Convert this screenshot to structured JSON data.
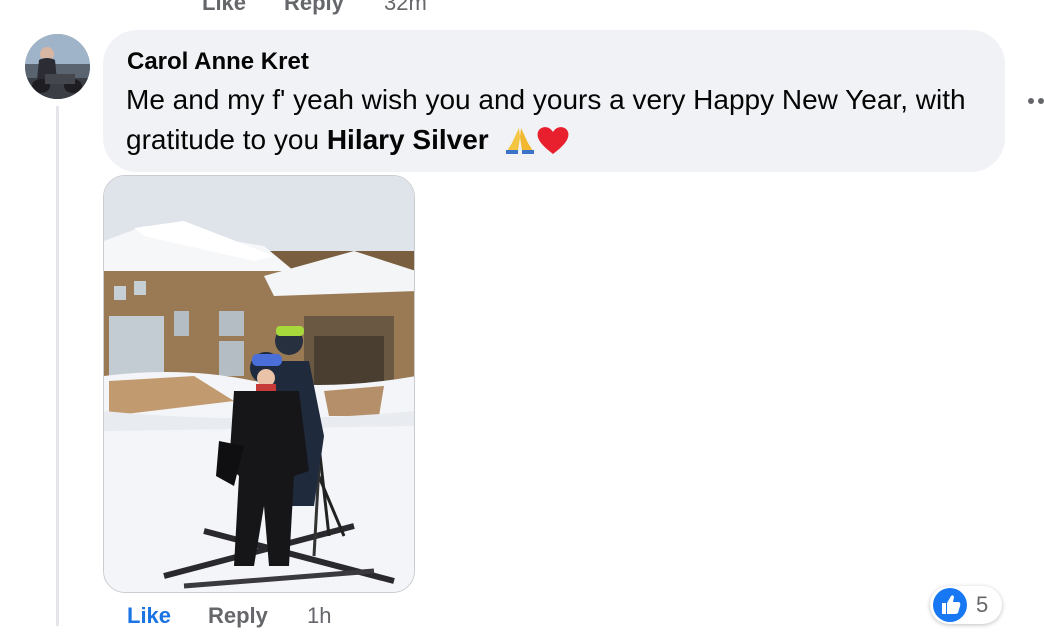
{
  "previous_comment_actions": {
    "like_label": "Like",
    "reply_label": "Reply",
    "timestamp": "32m"
  },
  "comment": {
    "author": "Carol Anne Kret",
    "text_main": "Me and my f' yeah wish you and yours a very Happy New Year, with gratitude to you",
    "mention": "Hilary Silver",
    "emojis": [
      "folded-hands-icon",
      "red-heart-icon"
    ]
  },
  "actions": {
    "like_label": "Like",
    "reply_label": "Reply",
    "timestamp": "1h"
  },
  "reactions": {
    "type_icon": "like-icon",
    "count": "5"
  },
  "colors": {
    "bubble_bg": "#f0f2f5",
    "like_blue": "#1877f2",
    "secondary_text": "#65676b",
    "heart_red": "#e8202e"
  }
}
